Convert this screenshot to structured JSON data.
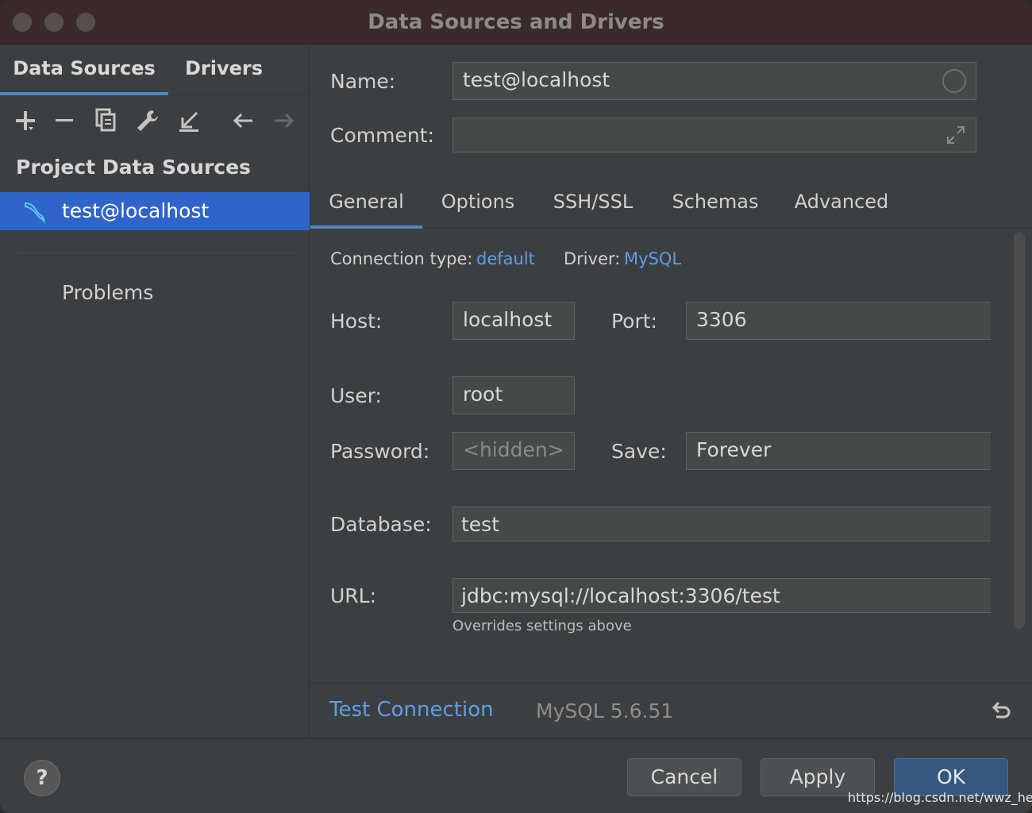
{
  "window": {
    "title": "Data Sources and Drivers"
  },
  "left": {
    "tabs": [
      {
        "label": "Data Sources"
      },
      {
        "label": "Drivers"
      }
    ],
    "toolbar": [
      "plus-icon",
      "minus-icon",
      "duplicate-icon",
      "wrench-icon",
      "import-icon",
      "back-arrow-icon",
      "forward-arrow-icon"
    ],
    "section_title": "Project Data Sources",
    "selected_item": "test@localhost",
    "problems_label": "Problems"
  },
  "right": {
    "name": {
      "label": "Name:",
      "value": "test@localhost"
    },
    "comment": {
      "label": "Comment:",
      "value": ""
    },
    "tabs": [
      {
        "label": "General"
      },
      {
        "label": "Options"
      },
      {
        "label": "SSH/SSL"
      },
      {
        "label": "Schemas"
      },
      {
        "label": "Advanced"
      }
    ],
    "connection_type": {
      "label": "Connection type:",
      "value": "default"
    },
    "driver": {
      "label": "Driver:",
      "value": "MySQL"
    },
    "host": {
      "label": "Host:",
      "value": "localhost"
    },
    "port": {
      "label": "Port:",
      "value": "3306"
    },
    "user": {
      "label": "User:",
      "value": "root"
    },
    "password": {
      "label": "Password:",
      "placeholder": "<hidden>"
    },
    "save": {
      "label": "Save:",
      "value": "Forever"
    },
    "database": {
      "label": "Database:",
      "value": "test"
    },
    "url": {
      "label": "URL:",
      "value": "jdbc:mysql://localhost:3306/test",
      "hint": "Overrides settings above"
    },
    "test_connection": "Test Connection",
    "version": "MySQL 5.6.51"
  },
  "footer": {
    "help": "?",
    "cancel": "Cancel",
    "apply": "Apply",
    "ok": "OK",
    "watermark": "https://blog.csdn.net/wwz_henu"
  },
  "colors": {
    "accent": "#4a88c7",
    "selection": "#2f65ca",
    "link": "#5e9ee6",
    "ok_button": "#365880"
  }
}
